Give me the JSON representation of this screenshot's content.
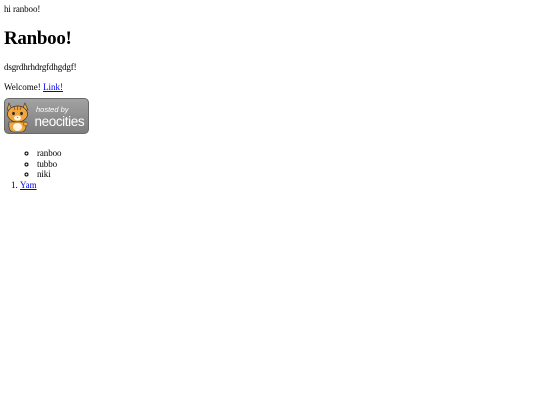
{
  "greeting": "hi ranboo!",
  "heading": "Ranboo!",
  "junk_text": "dsgrdhrhdrgfdhgdgf!",
  "welcome": {
    "text": "Welcome!",
    "link_label": "Link!"
  },
  "badge": {
    "line1": "hosted by",
    "line2": "neocities",
    "icon": "neocities-cat-icon"
  },
  "names_list": [
    "ranboo",
    "tubbo",
    "niki"
  ],
  "ordered_list": [
    "Yam"
  ],
  "colors": {
    "link": "#0000ee",
    "badge_bg": "#8f8f8f",
    "badge_text": "#ffffff",
    "cat": "#f2a53a"
  }
}
